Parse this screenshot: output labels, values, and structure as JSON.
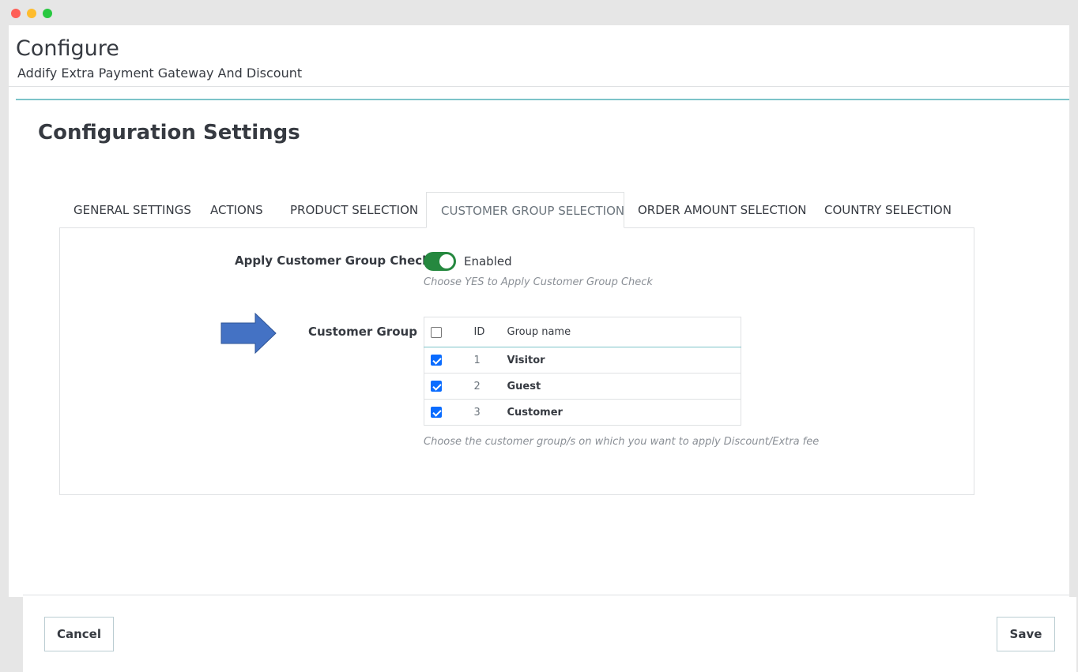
{
  "page": {
    "title": "Configure",
    "subtitle": "Addify Extra Payment Gateway And Discount"
  },
  "panel": {
    "title": "Configuration Settings"
  },
  "tabs": [
    {
      "label": "GENERAL SETTINGS"
    },
    {
      "label": "ACTIONS"
    },
    {
      "label": "PRODUCT SELECTION"
    },
    {
      "label": "CUSTOMER GROUP SELECTION",
      "active": true
    },
    {
      "label": "ORDER AMOUNT SELECTION"
    },
    {
      "label": "COUNTRY SELECTION"
    }
  ],
  "form": {
    "apply_check_label": "Apply Customer Group Check",
    "toggle_state": "Enabled",
    "toggle_help": "Choose YES to Apply Customer Group Check",
    "customer_group_label": "Customer Group",
    "group_help": "Choose the customer group/s on which you want to apply Discount/Extra fee",
    "table": {
      "headers": {
        "id": "ID",
        "name": "Group name"
      },
      "header_checked": false,
      "rows": [
        {
          "id": "1",
          "name": "Visitor",
          "checked": true
        },
        {
          "id": "2",
          "name": "Guest",
          "checked": true
        },
        {
          "id": "3",
          "name": "Customer",
          "checked": true
        }
      ]
    }
  },
  "footer": {
    "cancel_label": "Cancel",
    "save_label": "Save"
  },
  "colors": {
    "toggle_on": "#25883f",
    "accent_border": "#7cc3c9",
    "arrow": "#4472c4",
    "checkbox": "#0a6cff"
  }
}
